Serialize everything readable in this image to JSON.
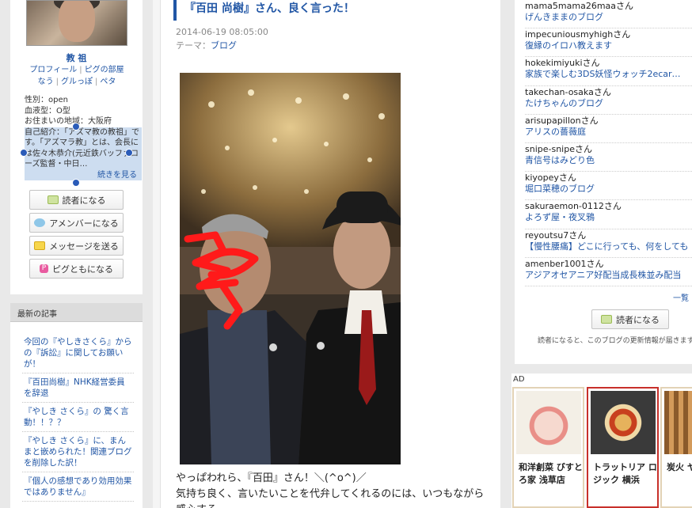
{
  "profile": {
    "name": "教 祖",
    "links": [
      "プロフィール",
      "ピグの部屋",
      "なう",
      "グルっぽ",
      "ペタ"
    ],
    "info": [
      "性別：open",
      "血液型：O型",
      "お住まいの地域：大阪府"
    ],
    "intro": "自己紹介：「アズマ教の教祖」です。「アズマラ教」とは、会長には佐々木恭介(元近鉄バッファローズ監督・中日…",
    "intro_more": "続きを見る",
    "buttons": [
      "読者になる",
      "アメンバーになる",
      "メッセージを送る",
      "ピグともになる"
    ]
  },
  "recent": {
    "heading": "最新の記事",
    "items": [
      "今回の『やしきさくら』からの『訴訟』に関してお願いが！",
      "『百田尚樹』NHK経営委員 を辞退",
      "『やしき さくら』の 驚く言動！！？？",
      "『やしき さくら』に、まんまと嵌められた！関連ブログを削除した訳！",
      "『個人の感想であり効用効果ではありません』"
    ]
  },
  "post": {
    "title": "『百田 尚樹』さん、良く言った！",
    "date": "2014-06-19 08:05:00",
    "theme_label": "テーマ：",
    "theme": "ブログ",
    "body_lines": [
      "やっぱわれら、『百田』さん！＼(^o^)／",
      "気持ち良く、言いたいことを代弁してくれるのには、いつもながら感心する。"
    ]
  },
  "readers": [
    {
      "name": "mama5mama26maaさん",
      "blog": "げんきままのブログ"
    },
    {
      "name": "impecuniousmyhighさん",
      "blog": "復縁のイロハ教えます"
    },
    {
      "name": "hokekimiyukiさん",
      "blog": "家族で楽しむ3DS妖怪ウォッチ2ecar…"
    },
    {
      "name": "takechan-osakaさん",
      "blog": "たけちゃんのブログ"
    },
    {
      "name": "arisupapillonさん",
      "blog": "アリスの薔薇庭"
    },
    {
      "name": "snipe-snipeさん",
      "blog": "青信号はみどり色"
    },
    {
      "name": "kiyopeyさん",
      "blog": "堀口菜穂のブログ"
    },
    {
      "name": "sakuraemon-0112さん",
      "blog": "よろず屋・夜叉鴉"
    },
    {
      "name": "reyoutsu7さん",
      "blog": "【慢性腰痛】どこに行っても、何をしても"
    },
    {
      "name": "amenber1001さん",
      "blog": "アジアオセアニア好配当成長株並み配当"
    }
  ],
  "sidebar": {
    "more": "一覧",
    "reader_button": "読者になる",
    "note": "読者になると、このブログの更新情報が届きます"
  },
  "ad": {
    "label": "AD",
    "cards": [
      {
        "text": "和洋創菜 びすとろ家 浅草店"
      },
      {
        "text": "トラットリア ロジック 横浜"
      },
      {
        "text": "炭火 ヤ 伝兵衛"
      }
    ]
  },
  "colors": {
    "link": "#2156a5",
    "selection": "#cdddf0",
    "ad_selected": "#c8302a"
  }
}
